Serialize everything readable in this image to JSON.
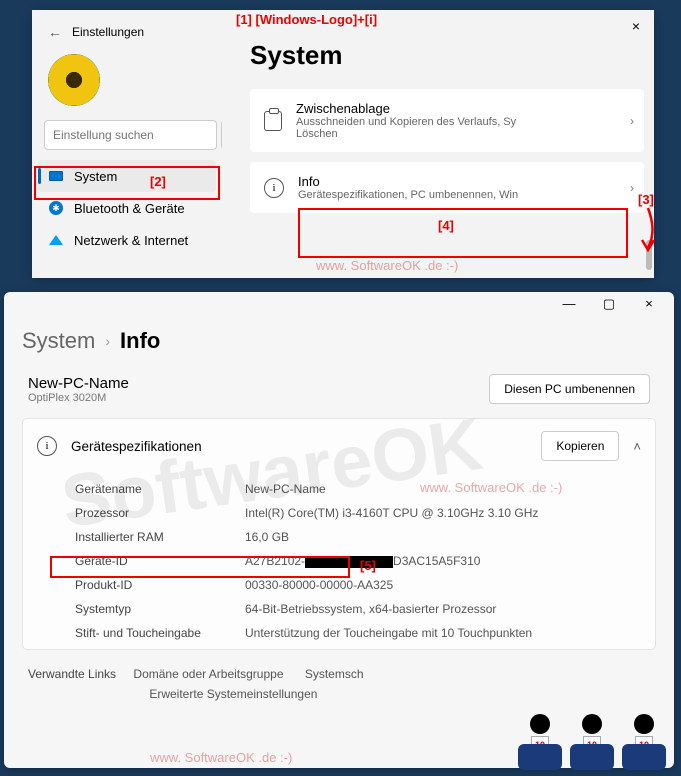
{
  "annotations": {
    "a1": "[1] [Windows-Logo]+[i]",
    "a2": "[2]",
    "a3": "[3]",
    "a4": "[4]",
    "a5": "[5]"
  },
  "top_window": {
    "header": "Einstellungen",
    "search_placeholder": "Einstellung suchen",
    "close": "×",
    "title": "System",
    "nav": [
      {
        "label": "System"
      },
      {
        "label": "Bluetooth & Geräte"
      },
      {
        "label": "Netzwerk & Internet"
      }
    ],
    "tiles": {
      "clipboard": {
        "title": "Zwischenablage",
        "sub": "Ausschneiden und Kopieren des Verlaufs, Sy",
        "sub2": "Löschen"
      },
      "info": {
        "title": "Info",
        "sub": "Gerätespezifikationen, PC umbenennen, Win"
      }
    }
  },
  "bottom_window": {
    "controls": {
      "min": "—",
      "max": "▢",
      "close": "×"
    },
    "breadcrumb": {
      "system": "System",
      "info": "Info"
    },
    "pc": {
      "name": "New-PC-Name",
      "model": "OptiPlex 3020M"
    },
    "rename_btn": "Diesen PC umbenennen",
    "spec_title": "Gerätespezifikationen",
    "copy_btn": "Kopieren",
    "specs": {
      "devicename_k": "Gerätename",
      "devicename_v": "New-PC-Name",
      "cpu_k": "Prozessor",
      "cpu_v": "Intel(R) Core(TM) i3-4160T CPU @ 3.10GHz   3.10 GHz",
      "ram_k": "Installierter RAM",
      "ram_v": "16,0 GB",
      "devid_k": "Geräte-ID",
      "devid_v_a": "A27B2102-",
      "devid_v_b": "D3AC15A5F310",
      "prodid_k": "Produkt-ID",
      "prodid_v": "00330-80000-00000-AA325",
      "systype_k": "Systemtyp",
      "systype_v": "64-Bit-Betriebssystem, x64-basierter Prozessor",
      "pen_k": "Stift- und Toucheingabe",
      "pen_v": "Unterstützung der Toucheingabe mit 10 Touchpunkten"
    },
    "links": {
      "label": "Verwandte Links",
      "l1": "Domäne oder Arbeitsgruppe",
      "l2": "Systemsch",
      "l3": "Erweiterte Systemeinstellungen"
    }
  },
  "watermarks": {
    "small": "www. SoftwareOK .de :-)",
    "big": "SoftwareOK",
    "score": "10"
  }
}
